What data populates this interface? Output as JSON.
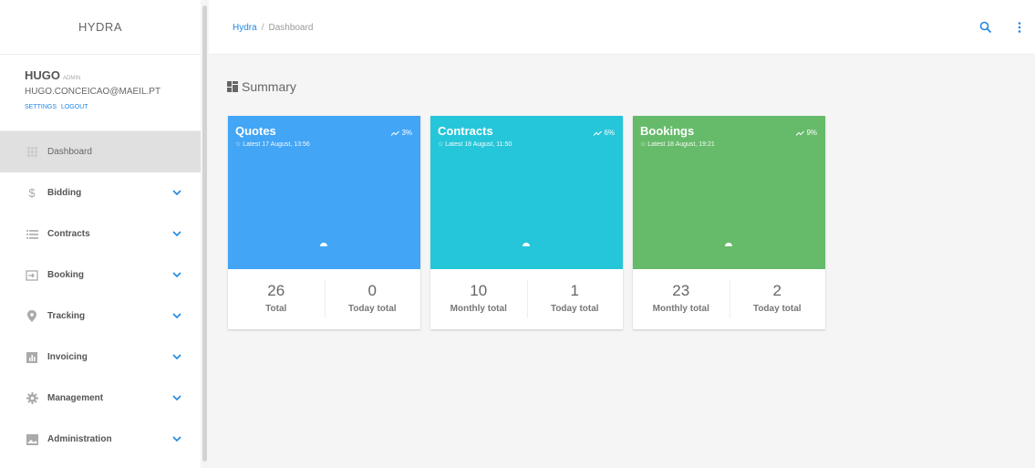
{
  "sidebar": {
    "brand": "HYDRA",
    "user": {
      "name": "HUGO",
      "role": "ADMIN",
      "email": "HUGO.CONCEICAO@MAEIL.PT",
      "settings": "SETTINGS",
      "logout": "LOGOUT"
    },
    "items": [
      {
        "label": "Dashboard",
        "icon": "grid-icon",
        "active": true
      },
      {
        "label": "Bidding",
        "icon": "dollar-icon"
      },
      {
        "label": "Contracts",
        "icon": "list-icon"
      },
      {
        "label": "Booking",
        "icon": "login-icon"
      },
      {
        "label": "Tracking",
        "icon": "location-pin-icon"
      },
      {
        "label": "Invoicing",
        "icon": "bar-chart-icon"
      },
      {
        "label": "Management",
        "icon": "gear-icon"
      },
      {
        "label": "Administration",
        "icon": "image-icon"
      }
    ]
  },
  "header": {
    "breadcrumb_root": "Hydra",
    "breadcrumb_sep": "/",
    "breadcrumb_current": "Dashboard"
  },
  "main": {
    "section_title": "Summary",
    "cards": [
      {
        "title": "Quotes",
        "subtitle": "☆ Latest 17 August, 13:56",
        "trend": "3%",
        "color": "#42a5f5",
        "stats": [
          {
            "value": "26",
            "label": "Total"
          },
          {
            "value": "0",
            "label": "Today total"
          }
        ]
      },
      {
        "title": "Contracts",
        "subtitle": "☆ Latest 18 August, 11:50",
        "trend": "6%",
        "color": "#26c6da",
        "stats": [
          {
            "value": "10",
            "label": "Monthly total"
          },
          {
            "value": "1",
            "label": "Today total"
          }
        ]
      },
      {
        "title": "Bookings",
        "subtitle": "☆ Latest 18 August, 19:21",
        "trend": "9%",
        "color": "#66bb6a",
        "stats": [
          {
            "value": "23",
            "label": "Monthly total"
          },
          {
            "value": "2",
            "label": "Today total"
          }
        ]
      }
    ]
  },
  "colors": {
    "accent": "#1e88e5",
    "chevron": "#1e88e5"
  }
}
